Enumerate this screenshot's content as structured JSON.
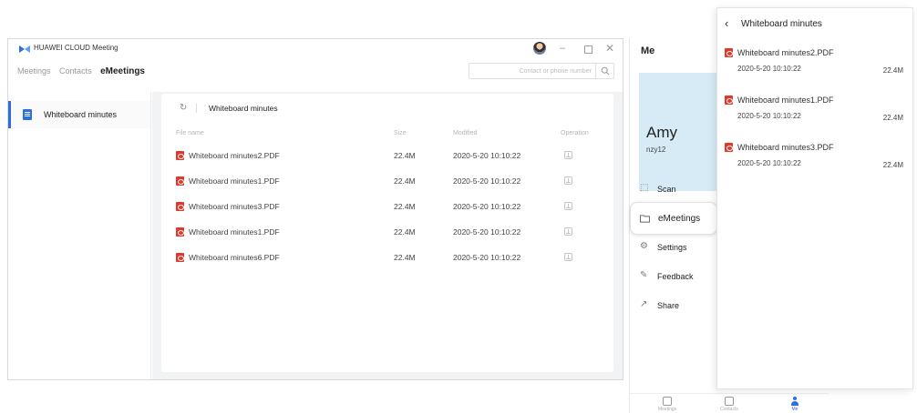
{
  "window": {
    "title": "HUAWEI CLOUD Meeting",
    "controls": {
      "minimize": "–",
      "close": "✕"
    }
  },
  "nav": {
    "tabs": [
      "Meetings",
      "Contacts",
      "eMeetings"
    ],
    "active": "eMeetings"
  },
  "search": {
    "placeholder": "Contact or phone number"
  },
  "sidebar": {
    "items": [
      {
        "label": "Whiteboard minutes",
        "icon": "document-icon"
      }
    ]
  },
  "content": {
    "title": "Whiteboard minutes",
    "columns": [
      "File name",
      "Size",
      "Modified",
      "Operation"
    ],
    "rows": [
      {
        "name": "Whiteboard minutes2.PDF",
        "size": "22.4M",
        "modified": "2020-5-20 10:10:22"
      },
      {
        "name": "Whiteboard minutes1.PDF",
        "size": "22.4M",
        "modified": "2020-5-20 10:10:22"
      },
      {
        "name": "Whiteboard minutes3.PDF",
        "size": "22.4M",
        "modified": "2020-5-20 10:10:22"
      },
      {
        "name": "Whiteboard minutes1.PDF",
        "size": "22.4M",
        "modified": "2020-5-20 10:10:22"
      },
      {
        "name": "Whiteboard minutes6.PDF",
        "size": "22.4M",
        "modified": "2020-5-20 10:10:22"
      }
    ]
  },
  "mobile": {
    "title": "Me",
    "profile": {
      "name": "Amy",
      "id": "nzy12"
    },
    "menu": [
      {
        "label": "Scan",
        "icon": "scan-icon"
      },
      {
        "label": "eMeetings",
        "icon": "folder-icon"
      },
      {
        "label": "Settings",
        "icon": "gear-icon"
      },
      {
        "label": "Feedback",
        "icon": "feedback-icon"
      },
      {
        "label": "Share",
        "icon": "share-icon"
      }
    ],
    "tabs": [
      {
        "label": "Meetings",
        "icon": "calendar-icon"
      },
      {
        "label": "Contacts",
        "icon": "contacts-icon"
      },
      {
        "label": "Me",
        "icon": "person-icon"
      }
    ]
  },
  "panel": {
    "title": "Whiteboard minutes",
    "files": [
      {
        "name": "Whiteboard minutes2.PDF",
        "modified": "2020-5-20 10:10:22",
        "size": "22.4M"
      },
      {
        "name": "Whiteboard minutes1.PDF",
        "modified": "2020-5-20 10:10:22",
        "size": "22.4M"
      },
      {
        "name": "Whiteboard minutes3.PDF",
        "modified": "2020-5-20 10:10:22",
        "size": "22.4M"
      }
    ]
  },
  "colors": {
    "accent": "#2d6fdc",
    "pdf": "#e0382b",
    "profile_bg": "#d7ebf7",
    "content_bg": "#f2f3f5"
  }
}
